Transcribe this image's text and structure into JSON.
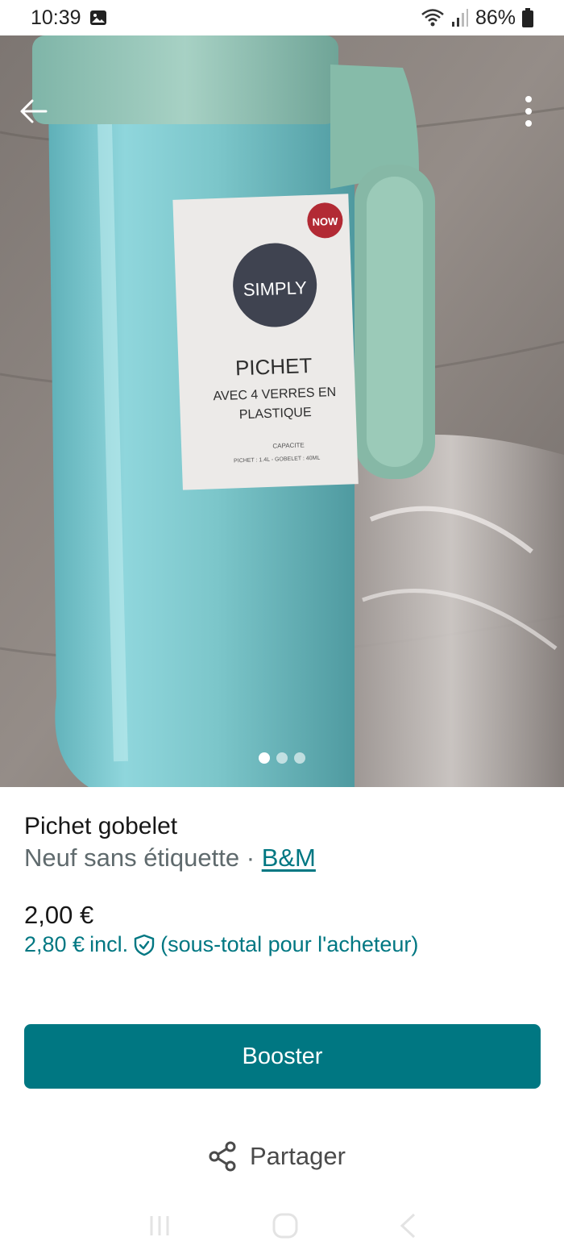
{
  "status_bar": {
    "time": "10:39",
    "battery": "86%",
    "icons": [
      "gallery-icon",
      "wifi-icon",
      "signal-icon",
      "battery-icon"
    ]
  },
  "photo": {
    "label": {
      "brand": "SIMPLY",
      "product": "PICHET",
      "line1": "AVEC 4 VERRES EN",
      "line2": "PLASTIQUE",
      "capacity_title": "CAPACITE",
      "capacity_detail": "PICHET : 1.4L - GOBELET : 40ML",
      "sticker": "NOW"
    },
    "image_count": 3,
    "active_index": 0
  },
  "product": {
    "title": "Pichet gobelet",
    "condition": "Neuf sans étiquette",
    "separator": " · ",
    "brand": "B&M",
    "price": "2,00 €",
    "total_price": "2,80 €",
    "total_incl": "incl.",
    "total_note": "(sous-total pour l'acheteur)"
  },
  "actions": {
    "booster_label": "Booster",
    "share_label": "Partager"
  },
  "colors": {
    "accent": "#007782",
    "text": "#171717",
    "muted": "#5f6a6d"
  }
}
